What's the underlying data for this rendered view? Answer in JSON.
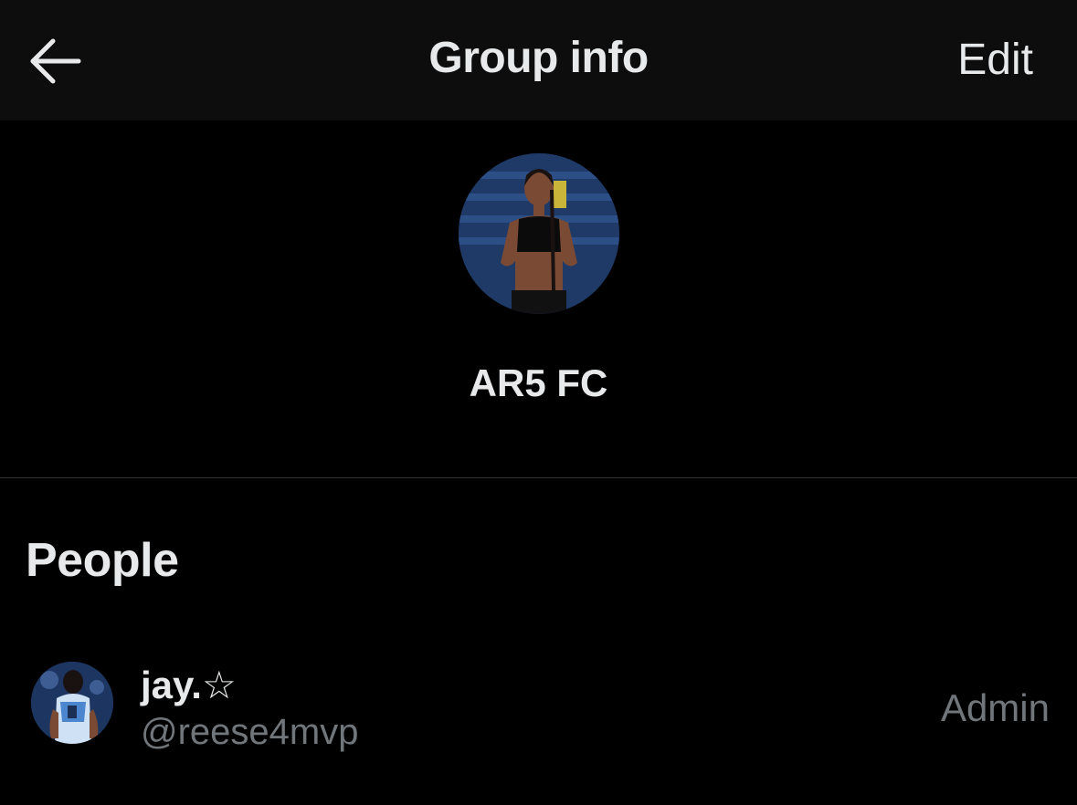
{
  "header": {
    "title": "Group info",
    "edit_label": "Edit",
    "back_icon": "arrow-left-icon"
  },
  "group": {
    "name": "AR5 FC",
    "avatar_icon": "group-photo"
  },
  "people": {
    "section_title": "People",
    "members": [
      {
        "display_name": "jay.☆",
        "handle": "@reese4mvp",
        "role": "Admin"
      }
    ]
  },
  "colors": {
    "background": "#000000",
    "header_background": "#0d0d0d",
    "primary_text": "#e7e9ea",
    "secondary_text": "#71767b",
    "divider": "#2f3336"
  }
}
